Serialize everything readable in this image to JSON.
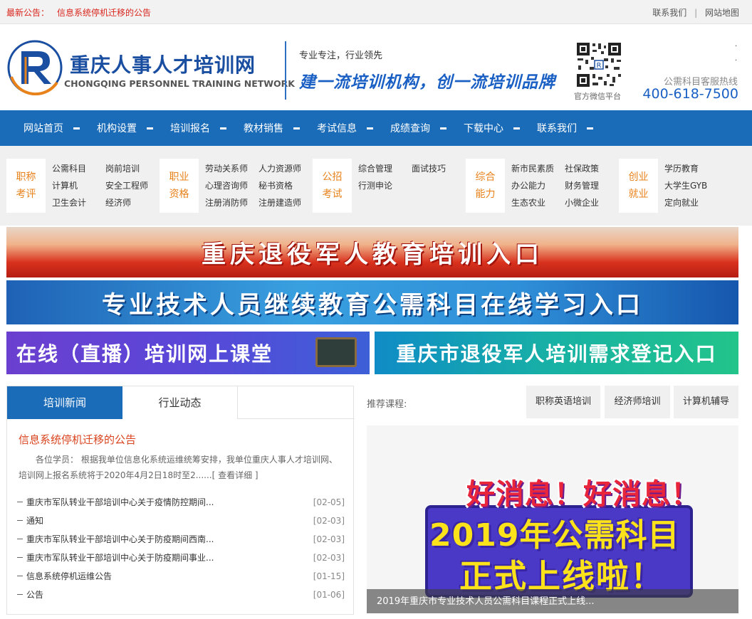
{
  "topbar": {
    "notice_label": "最新公告：",
    "notice_text": "信息系统停机迁移的公告",
    "links": [
      "联系我们",
      "网站地图"
    ],
    "separator": "|"
  },
  "header": {
    "logo_cn": "重庆人事人才培训网",
    "logo_en": "CHONGQING PERSONNEL TRAINING NETWORK",
    "slogan_small": "专业专注，行业领先",
    "slogan_big": "建一流培训机构，创一流培训品牌",
    "qr_label": "官方微信平台",
    "hotline_label": "公需科目客服热线",
    "hotline_number": "400-618-7500",
    "brand_color": "#1a6bb8",
    "accent_color": "#e8821a"
  },
  "nav": {
    "items": [
      "网站首页",
      "机构设置",
      "培训报名",
      "教材销售",
      "考试信息",
      "成绩查询",
      "下载中心",
      "联系我们"
    ]
  },
  "categories": [
    {
      "title": "职称考评",
      "cols": [
        [
          "公需科目",
          "计算机",
          "卫生会计"
        ],
        [
          "岗前培训",
          "安全工程师",
          "经济师"
        ]
      ]
    },
    {
      "title": "职业资格",
      "cols": [
        [
          "劳动关系师",
          "心理咨询师",
          "注册消防师"
        ],
        [
          "人力资源师",
          "秘书资格",
          "注册建造师"
        ]
      ]
    },
    {
      "title": "公招考试",
      "cols": [
        [
          "综合管理",
          "行测申论"
        ],
        [
          "面试技巧"
        ]
      ]
    },
    {
      "title": "综合能力",
      "cols": [
        [
          "新市民素质",
          "办公能力",
          "生态农业"
        ],
        [
          "社保政策",
          "财务管理",
          "小微企业"
        ]
      ]
    },
    {
      "title": "创业就业",
      "cols": [
        [
          "学历教育",
          "大学生GYB",
          "定向就业"
        ]
      ]
    }
  ],
  "banners": {
    "veterans_edu": "重庆退役军人教育培训入口",
    "continuing_edu": "专业技术人员继续教育公需科目在线学习入口",
    "online_class": "在线（直播）培训网上课堂",
    "veterans_register": "重庆市退役军人培训需求登记入口"
  },
  "news": {
    "tabs": [
      "培训新闻",
      "行业动态"
    ],
    "headline": "信息系统停机迁移的公告",
    "summary": "各位学员： 根据我单位信息化系统运维统筹安排，我单位重庆人事人才培训网、培训网上报名系统将于2020年4月2日18时至2......[ 查看详细 ]",
    "items": [
      {
        "title": "重庆市军队转业干部培训中心关于疫情防控期间...",
        "date": "[02-05]"
      },
      {
        "title": "通知",
        "date": "[02-03]"
      },
      {
        "title": "重庆市军队转业干部培训中心关于防疫期间西南...",
        "date": "[02-03]"
      },
      {
        "title": "重庆市军队转业干部培训中心关于防疫期间事业...",
        "date": "[02-03]"
      },
      {
        "title": "信息系统停机运维公告",
        "date": "[01-15]"
      },
      {
        "title": "公告",
        "date": "[01-06]"
      }
    ]
  },
  "recommend": {
    "label": "推荐课程:",
    "courses": [
      "职称英语培训",
      "经济师培训",
      "计算机辅导"
    ]
  },
  "feature": {
    "line1": "好消息！好消息！",
    "line2": "2019年公需科目",
    "line3": "正式上线啦！",
    "caption": "2019年重庆市专业技术人员公需科目课程正式上线..."
  }
}
